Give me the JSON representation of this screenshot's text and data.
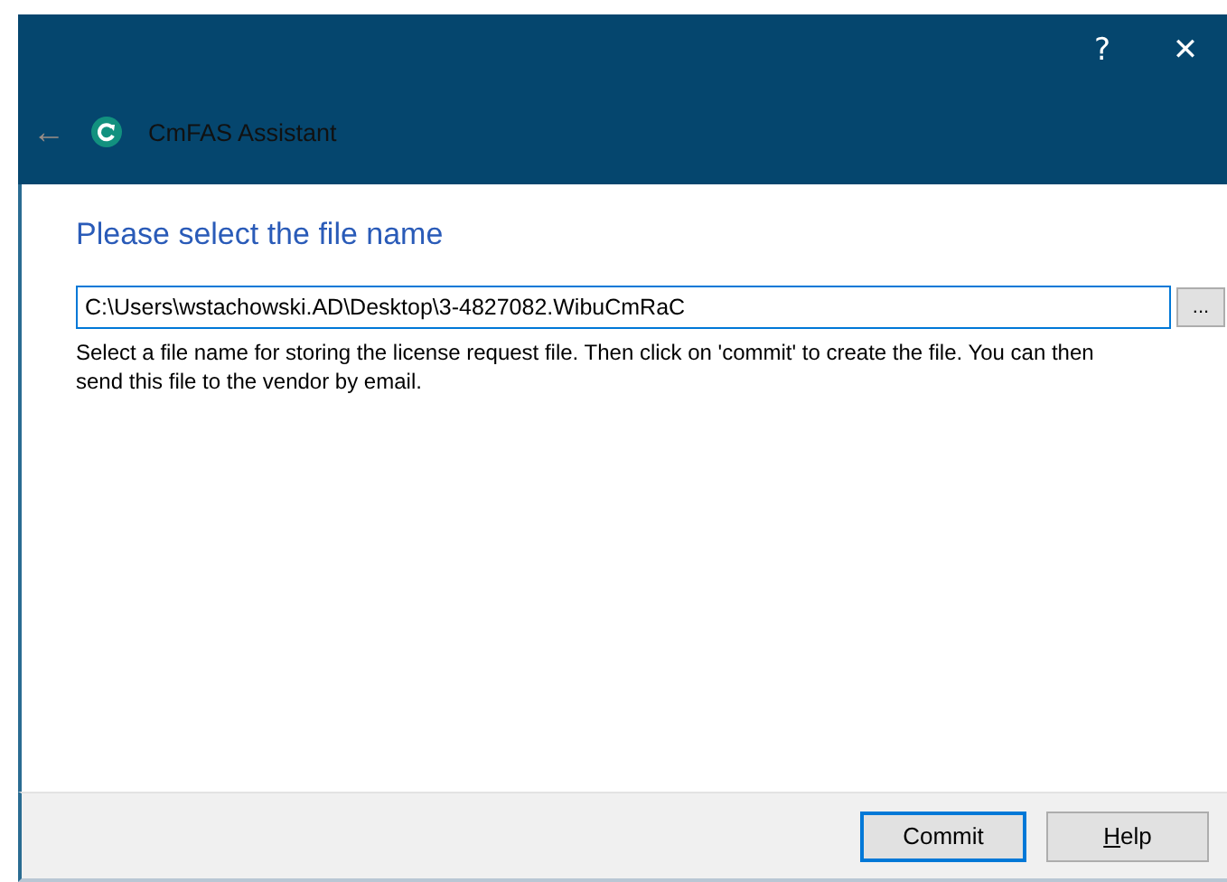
{
  "window": {
    "title": "CmFAS Assistant",
    "help_glyph": "?",
    "close_glyph": "✕",
    "back_glyph": "←"
  },
  "page": {
    "heading": "Please select the file name",
    "file_field": {
      "value": "C:\\Users\\wstachowski.AD\\Desktop\\3-4827082.WibuCmRaC",
      "focused": true
    },
    "browse_button": "...",
    "description": "Select a file name for storing the license request file. Then click on 'commit' to create the file. You can then send this file to the vendor by email."
  },
  "buttons": [
    {
      "label": "Commit",
      "default": true,
      "access_key_underlined": false
    },
    {
      "label": "Help",
      "default": false,
      "access_key_underlined": true
    }
  ]
}
